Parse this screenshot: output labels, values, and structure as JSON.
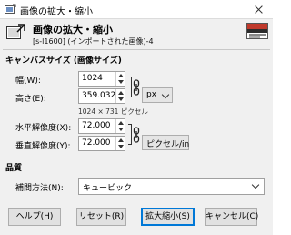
{
  "window": {
    "title": "画像の拡大・縮小"
  },
  "header": {
    "heading": "画像の拡大・縮小",
    "subtitle": "[s-l1600] (インポートされた画像)-4"
  },
  "canvas_size": {
    "section_label": "キャンバスサイズ (画像サイズ)",
    "width_label": "幅(W):",
    "width_value": "1024",
    "height_label": "高さ(E):",
    "height_value": "359.032",
    "unit_value": "px",
    "size_info": "1024 × 731 ピクセル",
    "xres_label": "水平解像度(X):",
    "xres_value": "72.000",
    "yres_label": "垂直解像度(Y):",
    "yres_value": "72.000",
    "res_unit_value": "ピクセル/in"
  },
  "quality": {
    "section_label": "品質",
    "interp_label": "補間方法(N):",
    "interp_value": "キュービック"
  },
  "buttons": {
    "help": "ヘルプ(H)",
    "reset": "リセット(R)",
    "scale": "拡大縮小(S)",
    "cancel": "キャンセル(C)"
  }
}
